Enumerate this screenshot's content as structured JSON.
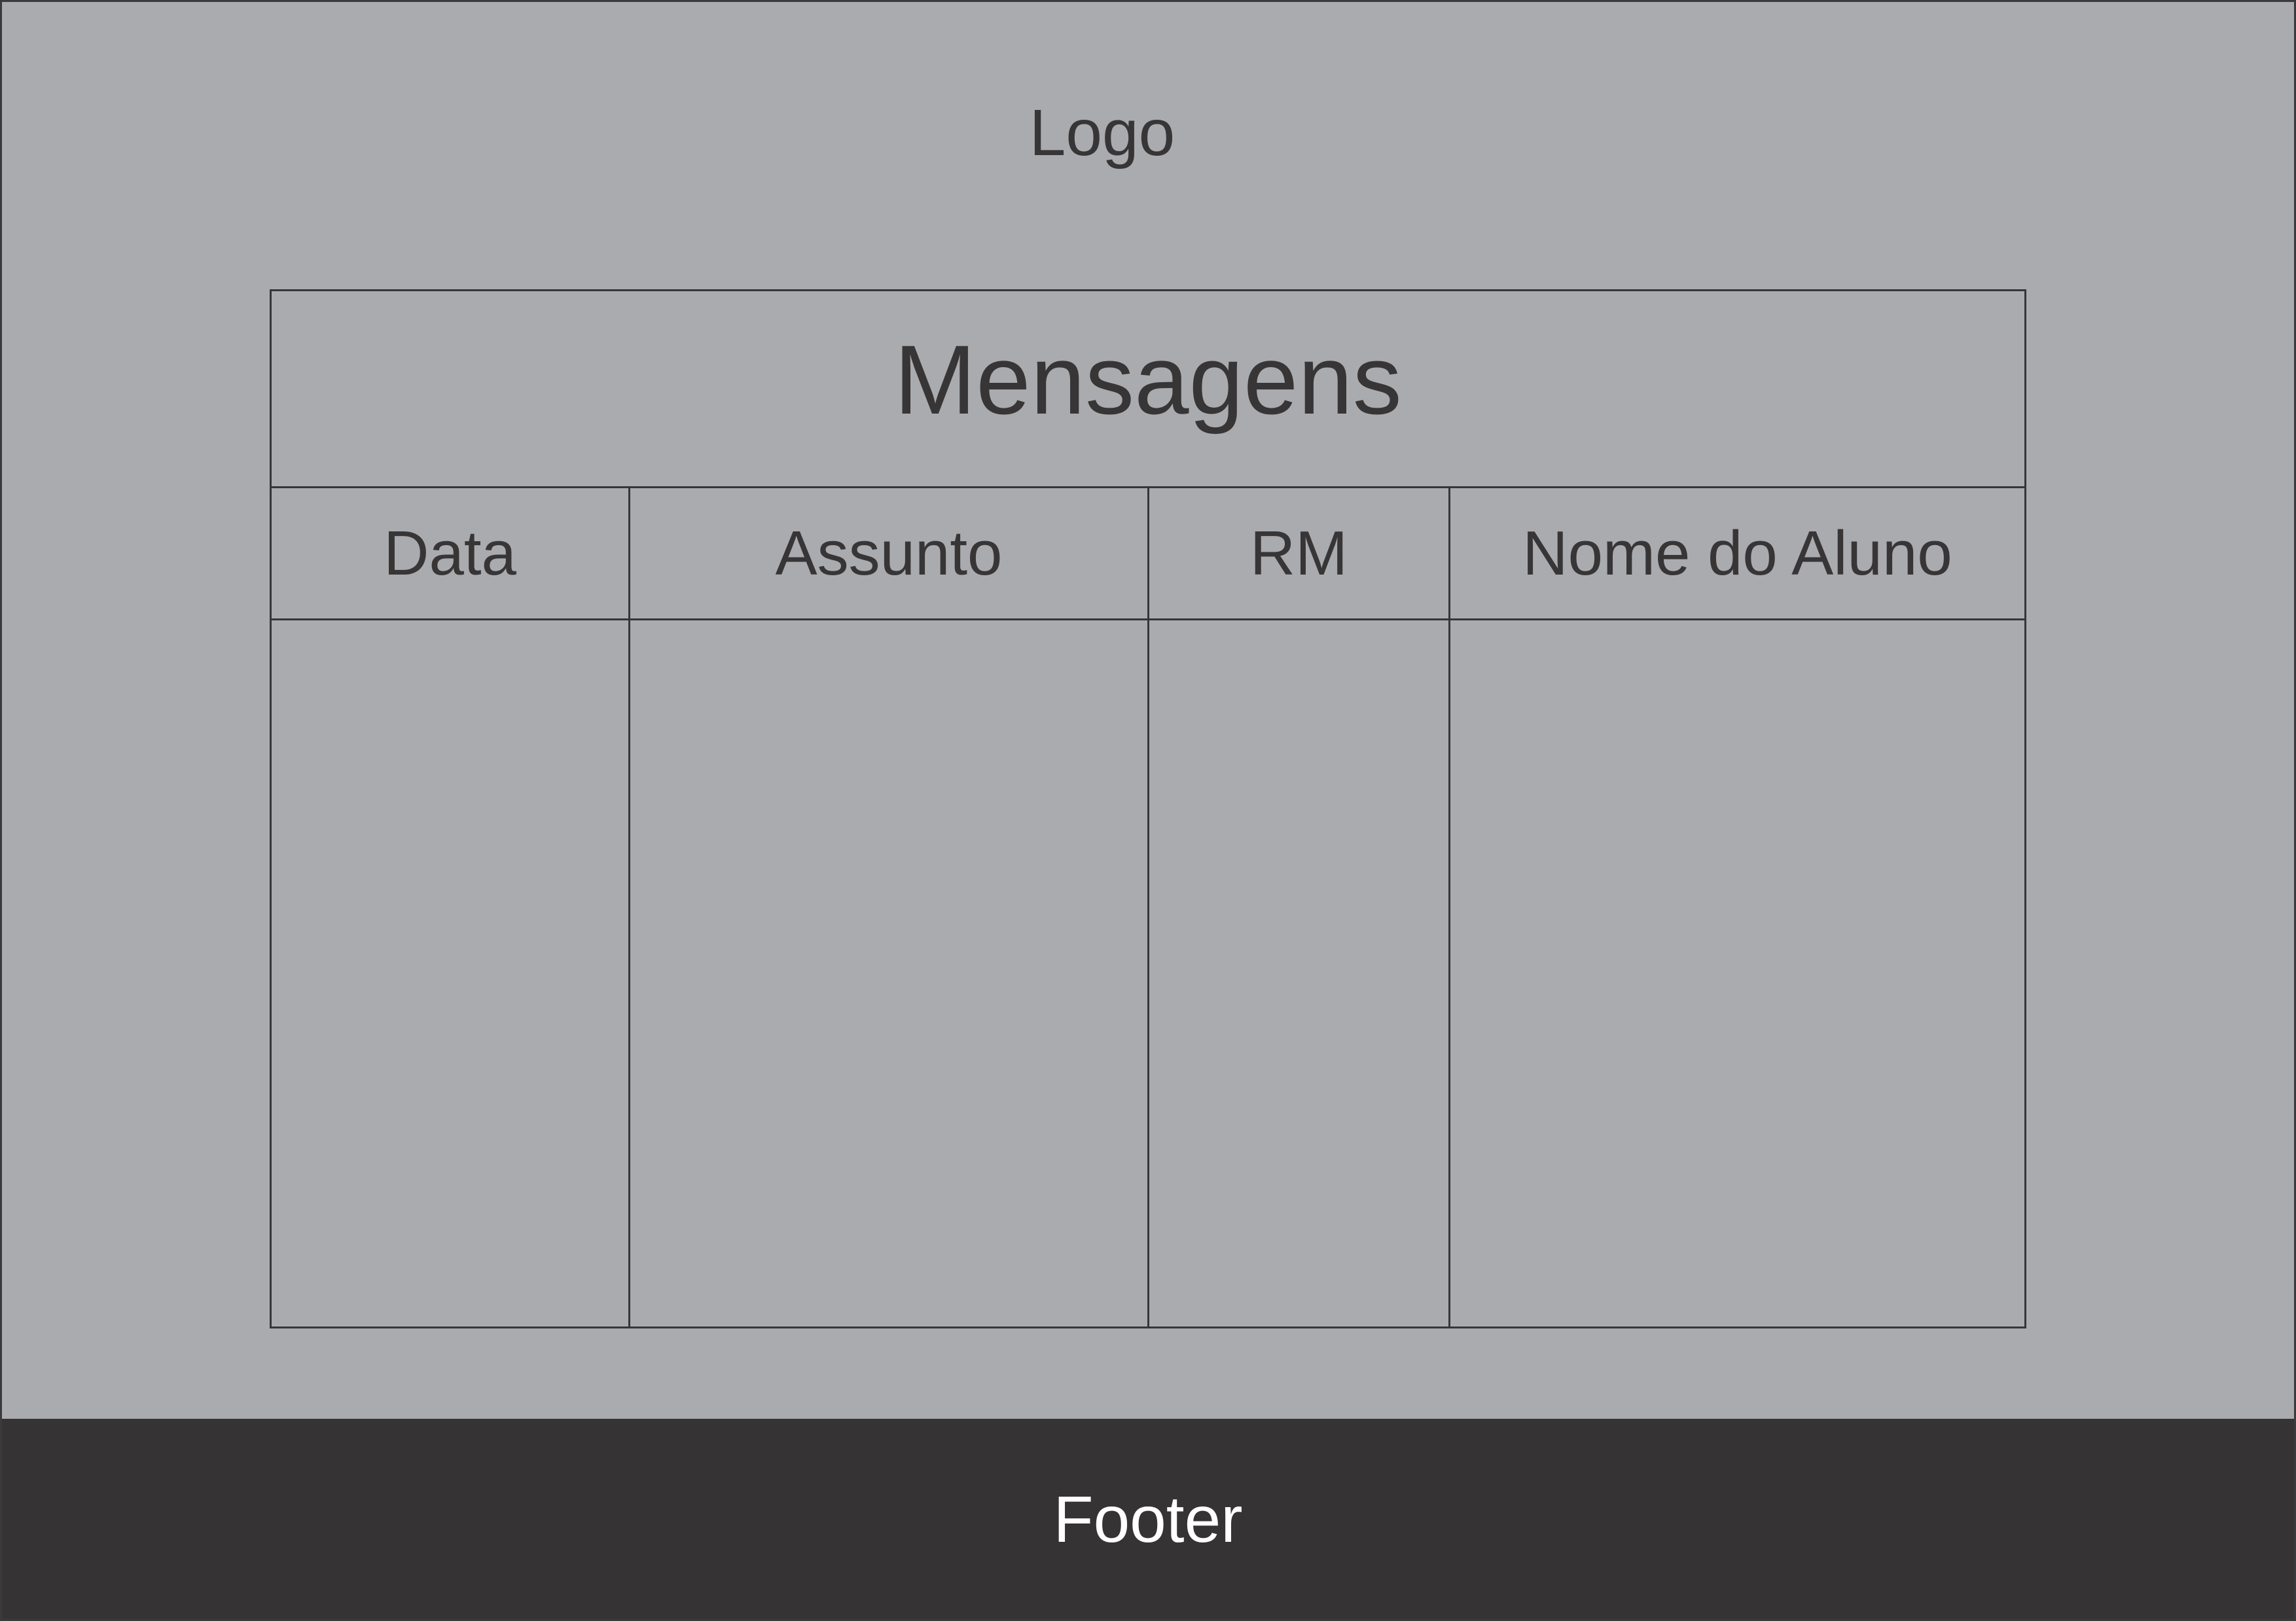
{
  "header": {
    "logo_text": "Logo"
  },
  "messages_table": {
    "title": "Mensagens",
    "columns": [
      {
        "label": "Data"
      },
      {
        "label": "Assunto"
      },
      {
        "label": "RM"
      },
      {
        "label": "Nome do Aluno"
      }
    ],
    "rows": []
  },
  "footer": {
    "text": "Footer"
  },
  "colors": {
    "background": "#aaabae",
    "footer_background": "#353334",
    "text": "#373536",
    "footer_text": "#ffffff"
  }
}
